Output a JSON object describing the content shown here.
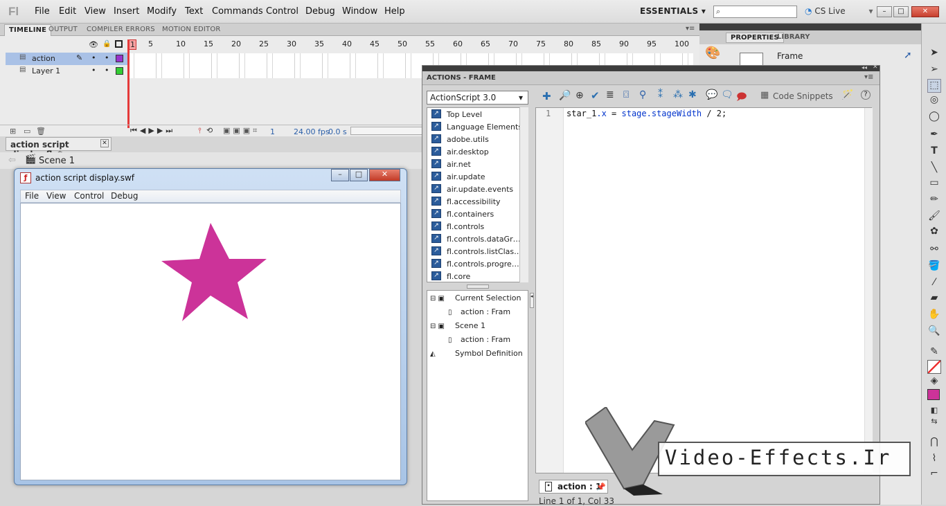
{
  "app": {
    "logo": "Fl",
    "menu": [
      "File",
      "Edit",
      "View",
      "Insert",
      "Modify",
      "Text",
      "Commands",
      "Control",
      "Debug",
      "Window",
      "Help"
    ],
    "workspace": "ESSENTIALS",
    "cslive": "CS Live"
  },
  "timeline": {
    "tabs": [
      "TIMELINE",
      "OUTPUT",
      "COMPILER ERRORS",
      "MOTION EDITOR"
    ],
    "frame_numbers": [
      "1",
      "5",
      "10",
      "15",
      "20",
      "25",
      "30",
      "35",
      "40",
      "45",
      "50",
      "55",
      "60",
      "65",
      "70",
      "75",
      "80",
      "85",
      "90",
      "95",
      "100"
    ],
    "layers": [
      {
        "name": "action",
        "color": "#9933cc"
      },
      {
        "name": "Layer 1",
        "color": "#33cc33"
      }
    ],
    "footer": {
      "frame": "1",
      "fps": "24.00 fps",
      "time": "0.0 s"
    }
  },
  "document": {
    "tab": "action script display.fla*",
    "scene": "Scene 1"
  },
  "swf_window": {
    "title": "action script display.swf",
    "menu": [
      "File",
      "View",
      "Control",
      "Debug"
    ],
    "star_color": "#cc3399"
  },
  "actions": {
    "title": "ACTIONS - FRAME",
    "language": "ActionScript 3.0",
    "toolbox": [
      "Top Level",
      "Language Elements",
      "adobe.utils",
      "air.desktop",
      "air.net",
      "air.update",
      "air.update.events",
      "fl.accessibility",
      "fl.containers",
      "fl.controls",
      "fl.controls.dataGr…",
      "fl.controls.listClas…",
      "fl.controls.progre…",
      "fl.core"
    ],
    "nav_tree": [
      {
        "label": "Current Selection",
        "indent": 0
      },
      {
        "label": "action : Fram",
        "indent": 1
      },
      {
        "label": "Scene 1",
        "indent": 0
      },
      {
        "label": "action : Fram",
        "indent": 1
      },
      {
        "label": "Symbol Definition",
        "indent": 0
      }
    ],
    "code_snippets": "Code Snippets",
    "line_number": "1",
    "code": "star_1.x = stage.stageWidth / 2;",
    "tab_label": "action : 1",
    "status": "Line 1 of 1, Col 33"
  },
  "properties": {
    "tabs": [
      "PROPERTIES",
      "LIBRARY"
    ],
    "frame_label": "Frame"
  },
  "watermark": "Video-Effects.Ir"
}
